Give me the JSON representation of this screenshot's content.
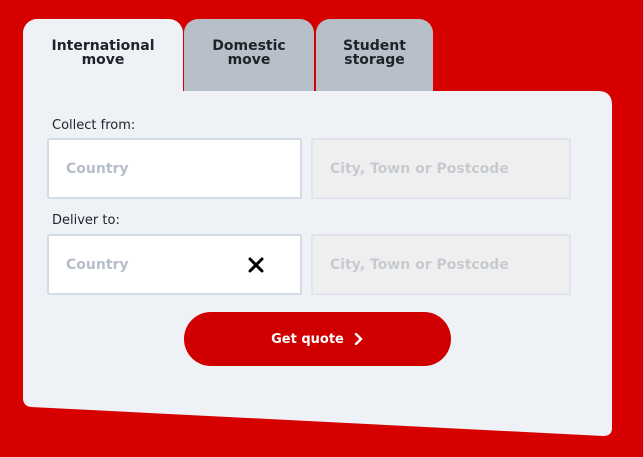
{
  "tabs": [
    {
      "label": "International\nmove",
      "active": true
    },
    {
      "label": "Domestic\nmove",
      "active": false
    },
    {
      "label": "Student\nstorage",
      "active": false
    }
  ],
  "collect": {
    "label": "Collect from:",
    "country_placeholder": "Country",
    "city_placeholder": "City, Town or Postcode"
  },
  "deliver": {
    "label": "Deliver to:",
    "country_placeholder": "Country",
    "city_placeholder": "City, Town or Postcode"
  },
  "button": {
    "label": "Get quote"
  },
  "colors": {
    "background": "#d60000",
    "panel": "#eef2f6",
    "inactive_tab": "#b7bfc8",
    "button": "#d00000"
  }
}
